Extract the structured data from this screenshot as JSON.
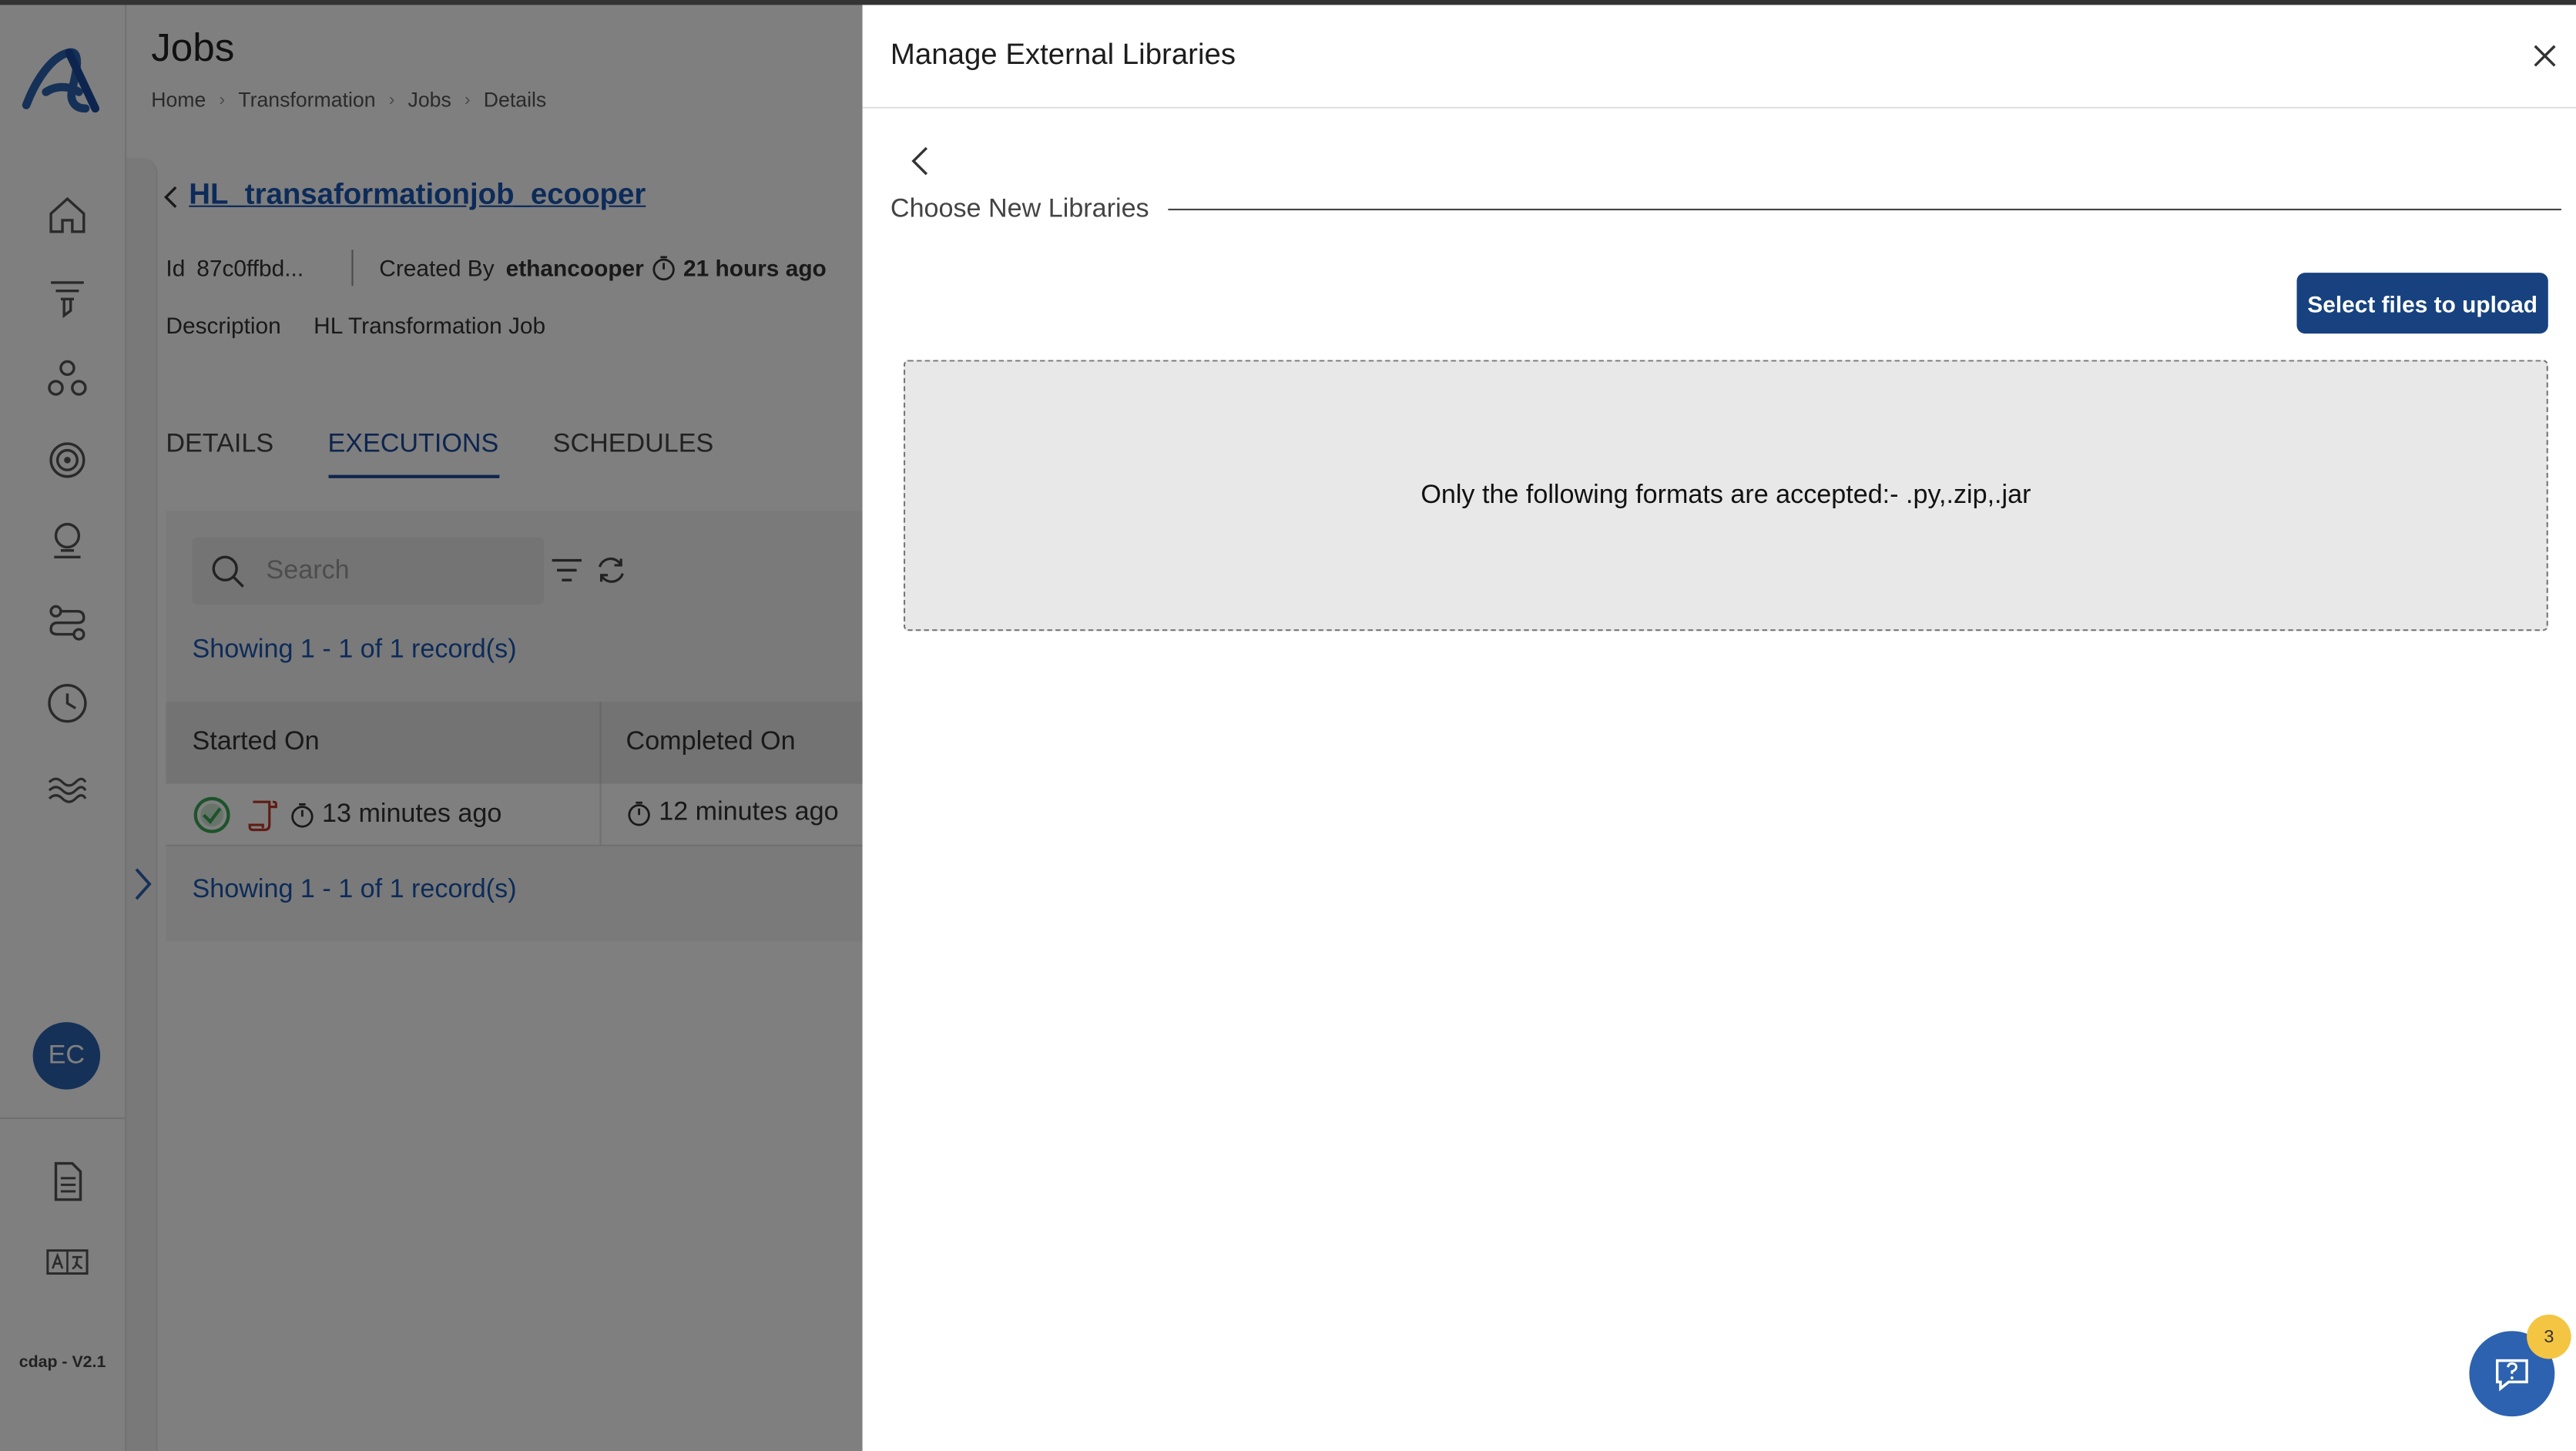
{
  "app": {
    "version_label": "cdap - V2.1",
    "user_initials": "EC",
    "colors": {
      "brand": "#17427f",
      "link": "#1a56b3",
      "avatar": "#2c62b0",
      "badge": "#f4c542",
      "success": "#3aa657",
      "error": "#c0392b"
    }
  },
  "sidebar": {
    "nav_icons": [
      "home-icon",
      "funnel-icon",
      "nodes-icon",
      "target-icon",
      "lightbulb-icon",
      "pipeline-icon",
      "clock-icon",
      "lake-icon"
    ],
    "bottom_icons": [
      "document-icon",
      "translate-icon"
    ]
  },
  "header": {
    "title": "Jobs",
    "breadcrumb": [
      "Home",
      "Transformation",
      "Jobs",
      "Details"
    ]
  },
  "job": {
    "name": "HL_transaformationjob_ecooper",
    "id_label": "Id",
    "id_value": "87c0ffbd...",
    "created_by_label": "Created By",
    "created_by_value": "ethancooper",
    "created_time": "21 hours ago",
    "description_label": "Description",
    "description_value": "HL Transformation Job"
  },
  "tabs": [
    {
      "label": "DETAILS",
      "active": false
    },
    {
      "label": "EXECUTIONS",
      "active": true
    },
    {
      "label": "SCHEDULES",
      "active": false
    }
  ],
  "executions": {
    "search_placeholder": "Search",
    "records_top": "Showing 1 - 1 of 1 record(s)",
    "records_bottom": "Showing 1 - 1 of 1 record(s)",
    "columns": [
      "Started On",
      "Completed On"
    ],
    "rows": [
      {
        "status": "success",
        "started": "13 minutes ago",
        "completed": "12 minutes ago"
      }
    ]
  },
  "drawer": {
    "title": "Manage External Libraries",
    "section_label": "Choose New Libraries",
    "upload_button": "Select files to upload",
    "dropzone_text": "Only the following formats are accepted:- .py,.zip,.jar"
  },
  "help": {
    "badge_count": "3"
  }
}
